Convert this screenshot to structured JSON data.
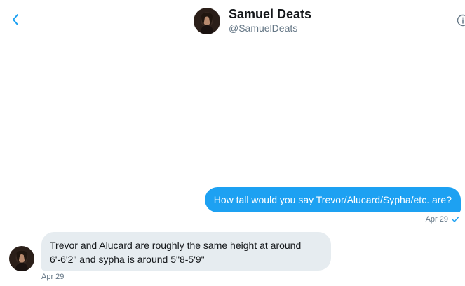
{
  "header": {
    "display_name": "Samuel Deats",
    "handle": "@SamuelDeats",
    "back_icon": "chevron-left-icon",
    "info_icon": "info-icon"
  },
  "conversation": {
    "messages": [
      {
        "direction": "sent",
        "text": "How tall would you say Trevor/Alucard/Sypha/etc. are?",
        "time": "Apr 29",
        "status_icon": "check-icon"
      },
      {
        "direction": "received",
        "text": "Trevor and Alucard are roughly the same height at around 6'-6'2\" and sypha is around 5\"8-5'9\"",
        "time": "Apr 29"
      }
    ]
  },
  "colors": {
    "accent": "#1da1f2",
    "received_bubble": "#e6ecf0",
    "secondary_text": "#657786",
    "primary_text": "#14171a"
  }
}
